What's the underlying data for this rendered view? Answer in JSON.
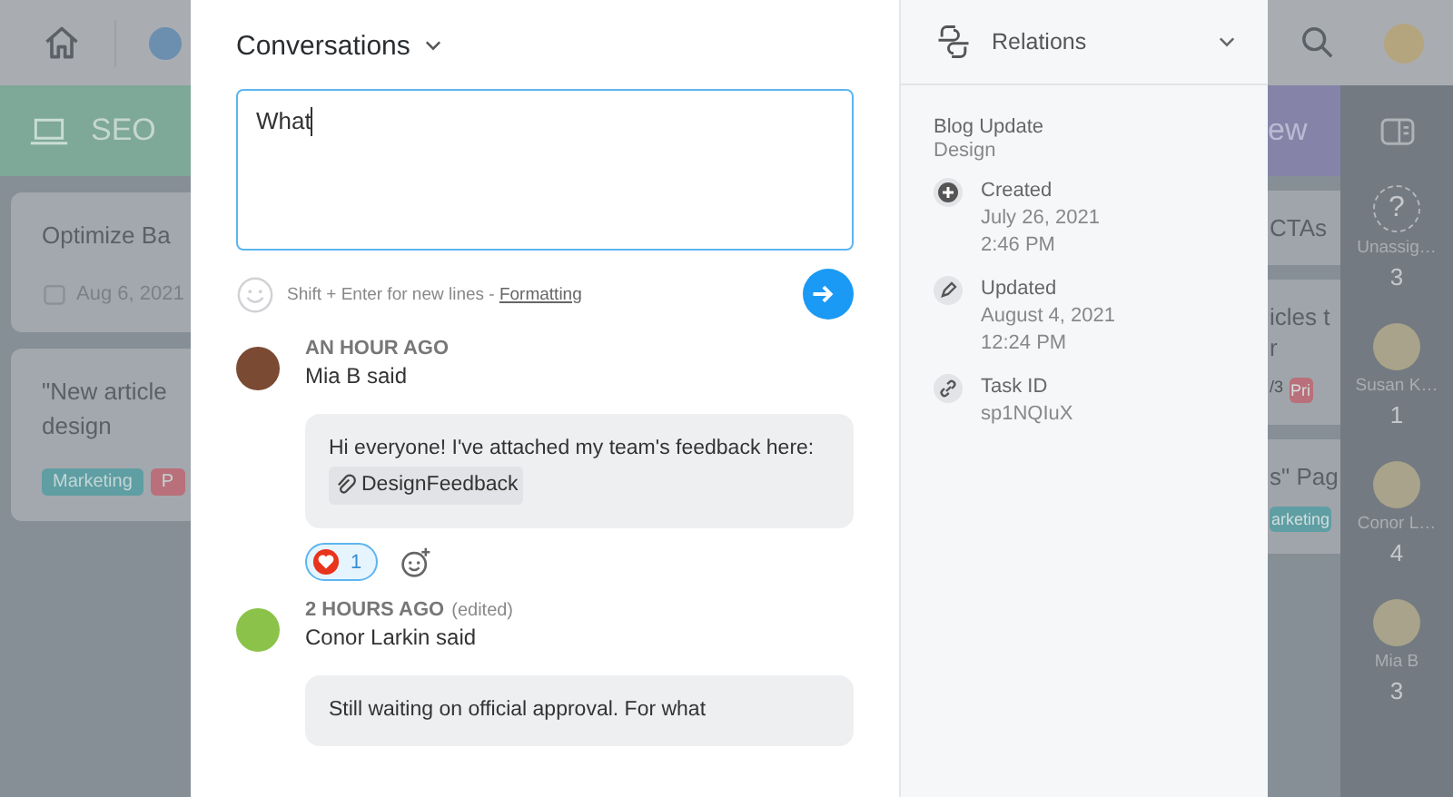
{
  "left_board": {
    "column": "SEO",
    "cards": [
      {
        "lines": [
          "Optimize Ba"
        ],
        "date": "Aug 6, 2021"
      },
      {
        "lines": [
          "\"New article",
          "design"
        ],
        "tags": [
          {
            "label": "Marketing",
            "color": "#5f9ea3"
          },
          {
            "label": "P",
            "color": "#b9707a"
          }
        ]
      }
    ]
  },
  "conversations": {
    "title": "Conversations",
    "composer": {
      "value": "What",
      "hint": "Shift + Enter for new lines - ",
      "link": "Formatting"
    },
    "comments": [
      {
        "time": "AN HOUR AGO",
        "author": "Mia B said",
        "body": "Hi everyone! I've attached my team's feedback here:",
        "attachment": "DesignFeedback",
        "reactions": [
          {
            "count": "1",
            "selected": true
          }
        ]
      },
      {
        "time": "2 HOURS AGO",
        "edited": "(edited)",
        "author": "Conor Larkin said",
        "body": "Still waiting on official approval. For what"
      }
    ]
  },
  "relations": {
    "title": "Relations",
    "task": "Blog Update",
    "list": "Design",
    "fields": [
      {
        "kind": "created",
        "label": "Created",
        "lines": [
          "July 26, 2021",
          "2:46 PM"
        ]
      },
      {
        "kind": "updated",
        "label": "Updated",
        "lines": [
          "August 4, 2021",
          "12:24 PM"
        ]
      },
      {
        "kind": "id",
        "label": "Task ID",
        "lines": [
          "sp1NQIuX"
        ]
      }
    ]
  },
  "right_board": {
    "column": "ew",
    "cards": [
      {
        "lines": [
          "CTAs"
        ]
      },
      {
        "lines": [
          "icles t",
          "r"
        ],
        "tags": [
          {
            "label": "/3"
          },
          {
            "label": "Pri",
            "color": "#b9707a"
          }
        ]
      },
      {
        "lines": [
          "s\" Pag"
        ],
        "tags": [
          {
            "label": "arketing",
            "color": "#5f9ea3"
          }
        ]
      }
    ]
  },
  "assignees": [
    {
      "kind": "unassigned",
      "symbol": "?",
      "name": "Unassig…",
      "count": "3"
    },
    {
      "kind": "person",
      "name": "Susan K…",
      "count": "1"
    },
    {
      "kind": "person",
      "name": "Conor L…",
      "count": "4"
    },
    {
      "kind": "person",
      "name": "Mia B",
      "count": "3"
    }
  ]
}
